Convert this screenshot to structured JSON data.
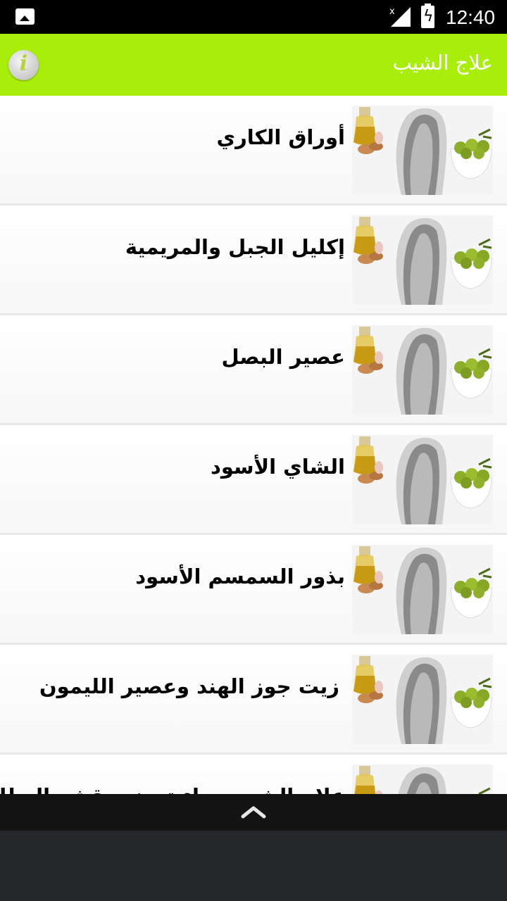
{
  "status_bar": {
    "time": "12:40",
    "icons": [
      "image-icon",
      "signal-icon",
      "battery-charging-icon"
    ]
  },
  "app_bar": {
    "title": "علاج الشيب",
    "info_icon_glyph": "i"
  },
  "items": [
    {
      "label": "أوراق الكاري"
    },
    {
      "label": "إكليل الجبل والمريمية"
    },
    {
      "label": "عصير البصل"
    },
    {
      "label": "الشاي الأسود"
    },
    {
      "label": "بذور السمسم الأسود"
    },
    {
      "label": "زيت جوز الهند وعصير الليمون"
    },
    {
      "label": "علاج الشيب بماء تحضير قشر البطاطس"
    }
  ],
  "colors": {
    "accent": "#a8ee0a",
    "status_bar": "#000000",
    "bottom_bar": "#131313"
  }
}
